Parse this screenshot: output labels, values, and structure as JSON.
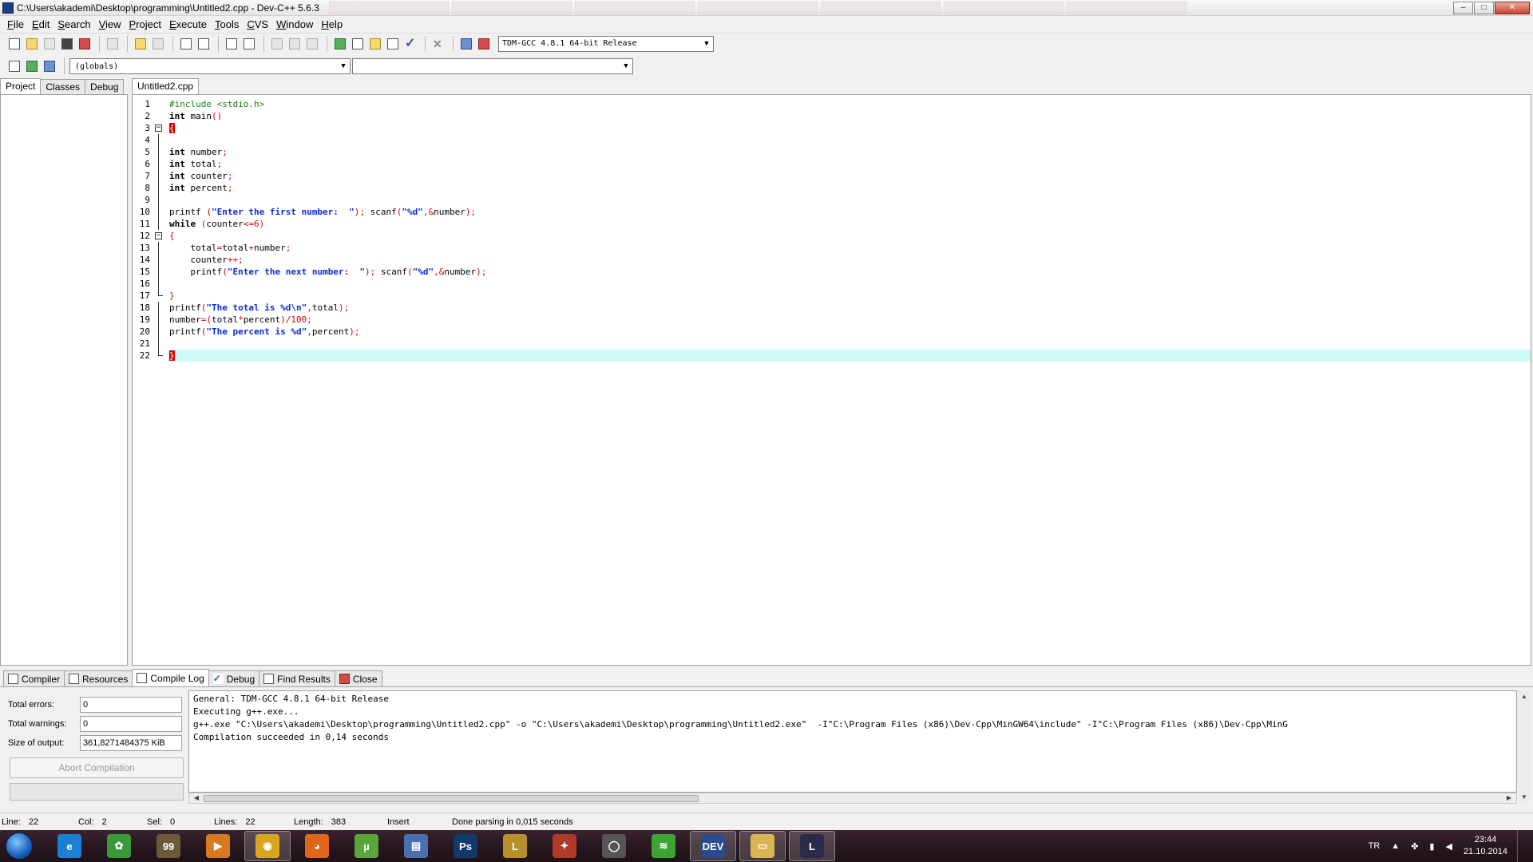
{
  "window": {
    "title": "C:\\Users\\akademi\\Desktop\\programming\\Untitled2.cpp - Dev-C++ 5.6.3",
    "controls": {
      "minimize": "–",
      "maximize": "□",
      "close": "✕"
    }
  },
  "menu": [
    {
      "key": "F",
      "rest": "ile"
    },
    {
      "key": "E",
      "rest": "dit"
    },
    {
      "key": "S",
      "rest": "earch"
    },
    {
      "key": "V",
      "rest": "iew"
    },
    {
      "key": "P",
      "rest": "roject"
    },
    {
      "key": "E",
      "rest": "xecute"
    },
    {
      "key": "T",
      "rest": "ools"
    },
    {
      "key": "C",
      "rest": "VS"
    },
    {
      "key": "W",
      "rest": "indow"
    },
    {
      "key": "H",
      "rest": "elp"
    }
  ],
  "toolbar": {
    "compiler_select": "TDM-GCC 4.8.1 64-bit Release",
    "scope_combo": "(globals)",
    "member_combo": ""
  },
  "left_panel": {
    "tabs": [
      "Project",
      "Classes",
      "Debug"
    ]
  },
  "editor": {
    "tab_label": "Untitled2.cpp",
    "current_line": 22
  },
  "bottom_panel": {
    "tabs": [
      "Compiler",
      "Resources",
      "Compile Log",
      "Debug",
      "Find Results",
      "Close"
    ],
    "total_errors_label": "Total errors:",
    "total_errors": "0",
    "total_warnings_label": "Total warnings:",
    "total_warnings": "0",
    "size_label": "Size of output:",
    "size_value": "361,8271484375 KiB",
    "abort_label": "Abort Compilation",
    "progress": 0,
    "log": [
      "General: TDM-GCC 4.8.1 64-bit Release",
      "Executing g++.exe...",
      "g++.exe \"C:\\Users\\akademi\\Desktop\\programming\\Untitled2.cpp\" -o \"C:\\Users\\akademi\\Desktop\\programming\\Untitled2.exe\"  -I\"C:\\Program Files (x86)\\Dev-Cpp\\MinGW64\\include\" -I\"C:\\Program Files (x86)\\Dev-Cpp\\MinG",
      "Compilation succeeded in 0,14 seconds"
    ]
  },
  "statusbar": {
    "line_label": "Line:",
    "line": "22",
    "col_label": "Col:",
    "col": "2",
    "sel_label": "Sel:",
    "sel": "0",
    "lines_label": "Lines:",
    "lines": "22",
    "length_label": "Length:",
    "length": "383",
    "mode": "Insert",
    "message": "Done parsing in 0,015 seconds"
  },
  "taskbar": {
    "icons": [
      {
        "name": "internet-explorer",
        "glyph": "e",
        "color": "#1b7fd6"
      },
      {
        "name": "nature-icon",
        "glyph": "✿",
        "color": "#3a9a3a"
      },
      {
        "name": "game-99",
        "glyph": "99",
        "color": "#6b5a3a"
      },
      {
        "name": "media-player",
        "glyph": "▶",
        "color": "#d87a20"
      },
      {
        "name": "chrome",
        "glyph": "◉",
        "color": "#d9a520"
      },
      {
        "name": "firefox",
        "glyph": "◕",
        "color": "#e0661b"
      },
      {
        "name": "utorrent",
        "glyph": "µ",
        "color": "#5aa63a"
      },
      {
        "name": "computer",
        "glyph": "▤",
        "color": "#4a6fb0"
      },
      {
        "name": "photoshop",
        "glyph": "Ps",
        "color": "#0f3a6a"
      },
      {
        "name": "league-legends",
        "glyph": "L",
        "color": "#b8902a"
      },
      {
        "name": "rust-game",
        "glyph": "✦",
        "color": "#b03a2a"
      },
      {
        "name": "app-ring",
        "glyph": "◯",
        "color": "#555555"
      },
      {
        "name": "spotify",
        "glyph": "≋",
        "color": "#3ca335"
      },
      {
        "name": "dev-cpp",
        "glyph": "DEV",
        "color": "#2a4c8e"
      },
      {
        "name": "explorer",
        "glyph": "▭",
        "color": "#d9b555"
      },
      {
        "name": "league-client",
        "glyph": "L",
        "color": "#2a2a4a"
      }
    ],
    "active": [
      "chrome",
      "dev-cpp",
      "explorer",
      "league-client"
    ],
    "lang": "TR",
    "time": "23:44",
    "date": "21.10.2014"
  }
}
